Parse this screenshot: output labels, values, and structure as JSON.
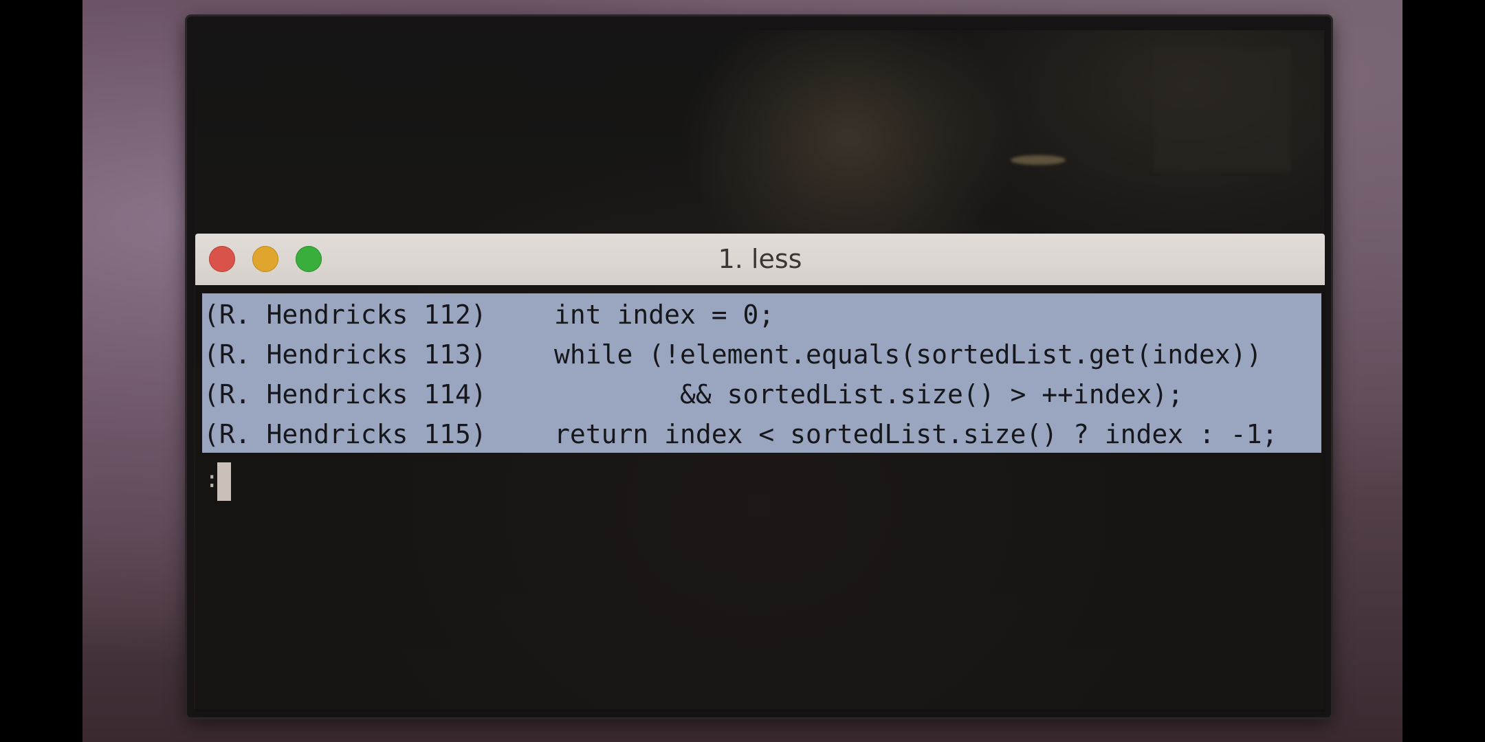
{
  "window": {
    "title": "1. less",
    "buttons": {
      "close_color": "#d9534a",
      "minimize_color": "#e0a52c",
      "zoom_color": "#3aae3d"
    }
  },
  "terminal": {
    "selection_color": "#9aa6bf",
    "lines": [
      {
        "blame": "(R. Hendricks 112)",
        "code": "int index = 0;"
      },
      {
        "blame": "(R. Hendricks 113)",
        "code": "while (!element.equals(sortedList.get(index))"
      },
      {
        "blame": "(R. Hendricks 114)",
        "code": "        && sortedList.size() > ++index);"
      },
      {
        "blame": "(R. Hendricks 115)",
        "code": "return index < sortedList.size() ? index : -1;"
      }
    ],
    "prompt": ":"
  }
}
